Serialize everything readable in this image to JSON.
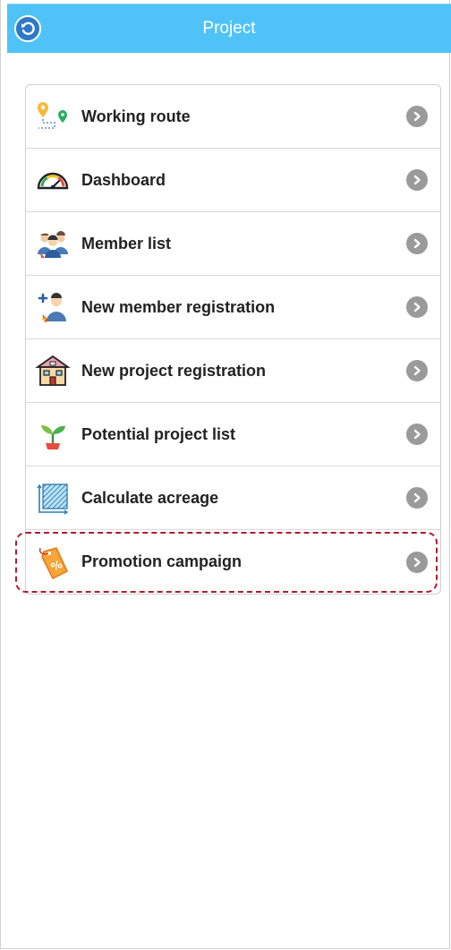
{
  "header": {
    "title": "Project",
    "back_icon": "back-icon",
    "color": "#4fc3f7"
  },
  "menu": {
    "items": [
      {
        "label": "Working route",
        "icon": "route-map-pin-icon"
      },
      {
        "label": "Dashboard",
        "icon": "gauge-icon"
      },
      {
        "label": "Member list",
        "icon": "people-group-icon"
      },
      {
        "label": "New member registration",
        "icon": "add-person-icon"
      },
      {
        "label": "New project registration",
        "icon": "house-icon"
      },
      {
        "label": "Potential project list",
        "icon": "sprout-icon"
      },
      {
        "label": "Calculate acreage",
        "icon": "area-measure-icon"
      },
      {
        "label": "Promotion campaign",
        "icon": "discount-tag-icon"
      }
    ],
    "highlighted_item": "Promotion campaign",
    "highlight_color": "#b01c2e"
  }
}
